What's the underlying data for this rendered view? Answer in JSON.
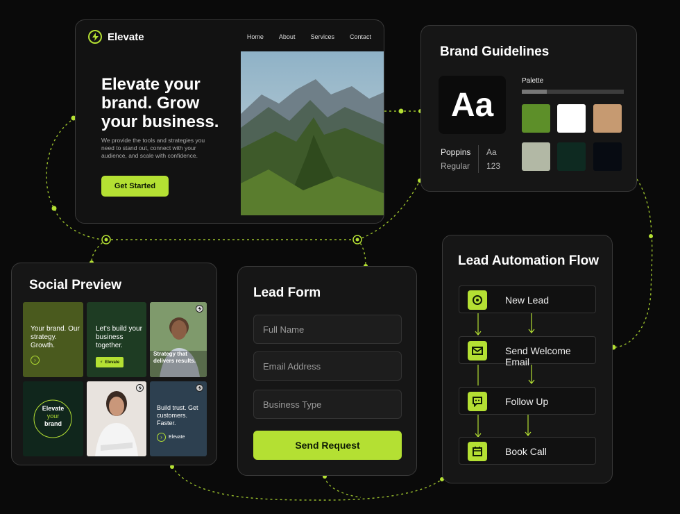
{
  "colors": {
    "accent": "#b4e033",
    "background": "#0a0a0a",
    "card": "#161616"
  },
  "website": {
    "logo_text": "Elevate",
    "nav": [
      "Home",
      "About",
      "Services",
      "Contact"
    ],
    "hero_title": "Elevate your brand. Grow your business.",
    "hero_desc": "We provide the tools and strategies you need to stand out, connect with your audience, and scale with confidence.",
    "cta": "Get Started"
  },
  "brand": {
    "title": "Brand Guidelines",
    "type_sample": "Aa",
    "font_name": "Poppins",
    "font_weight": "Regular",
    "glyph_letters": "Aa",
    "glyph_numbers": "123",
    "palette_label": "Palette",
    "swatches": [
      "#5d8f29",
      "#ffffff",
      "#c69a71",
      "#b2b8a5",
      "#0e2a21",
      "#070b12"
    ]
  },
  "social": {
    "title": "Social Preview",
    "tile1": "Your brand. Our strategy. Growth.",
    "tile2": "Let's build your business together.",
    "tile2_button": "Elevate",
    "tile3": "Strategy that delivers results.",
    "tile4_top": "Elevate",
    "tile4_mid": "your",
    "tile4_bottom": "brand",
    "tile6": "Build trust. Get customers. Faster.",
    "tile6_brand": "Elevate"
  },
  "form": {
    "title": "Lead Form",
    "full_name_placeholder": "Full Name",
    "email_placeholder": "Email Address",
    "business_placeholder": "Business Type",
    "submit": "Send Request"
  },
  "flow": {
    "title": "Lead Automation Flow",
    "steps": [
      {
        "label": "New Lead",
        "icon": "target-icon"
      },
      {
        "label": "Send Welcome Email",
        "icon": "mail-icon"
      },
      {
        "label": "Follow Up",
        "icon": "chat-icon"
      },
      {
        "label": "Book Call",
        "icon": "calendar-icon"
      }
    ]
  }
}
